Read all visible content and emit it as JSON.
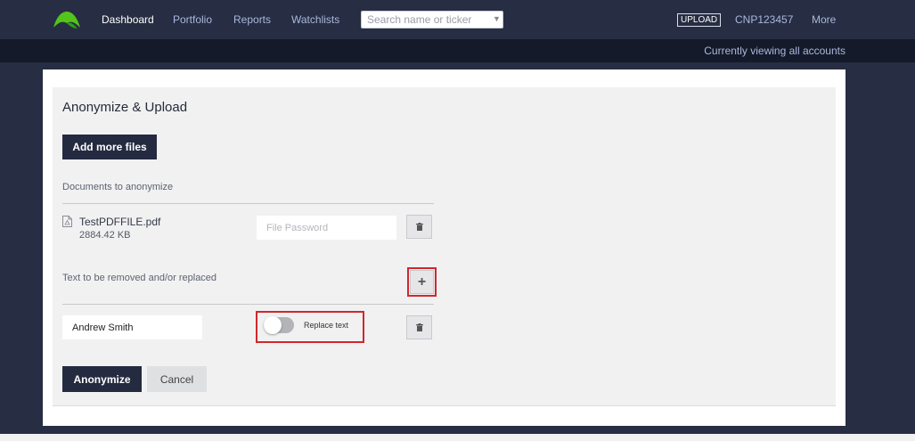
{
  "nav": {
    "items": [
      {
        "label": "Dashboard",
        "active": true
      },
      {
        "label": "Portfolio",
        "active": false
      },
      {
        "label": "Reports",
        "active": false
      },
      {
        "label": "Watchlists",
        "active": false
      }
    ],
    "search_placeholder": "Search name or ticker",
    "upload_label": "UPLOAD",
    "account_label": "CNP123457",
    "more_label": "More",
    "logo_color": "#52c41a"
  },
  "subbar": {
    "text": "Currently viewing all accounts"
  },
  "panel": {
    "title": "Anonymize & Upload",
    "add_files_label": "Add more files",
    "documents_label": "Documents to anonymize",
    "file": {
      "name": "TestPDFFILE.pdf",
      "size": "2884.42 KB",
      "icon": "pdf-file-icon",
      "password_placeholder": "File Password"
    },
    "text_removal_label": "Text to be removed and/or replaced",
    "removal_item": {
      "value": "Andrew Smith",
      "replace_label": "Replace text",
      "replace_enabled": false
    },
    "anonymize_label": "Anonymize",
    "cancel_label": "Cancel"
  },
  "colors": {
    "nav_bg": "#272d42",
    "subbar_bg": "#141a2a",
    "button_dark": "#242a3f",
    "highlight": "#d0272d"
  }
}
